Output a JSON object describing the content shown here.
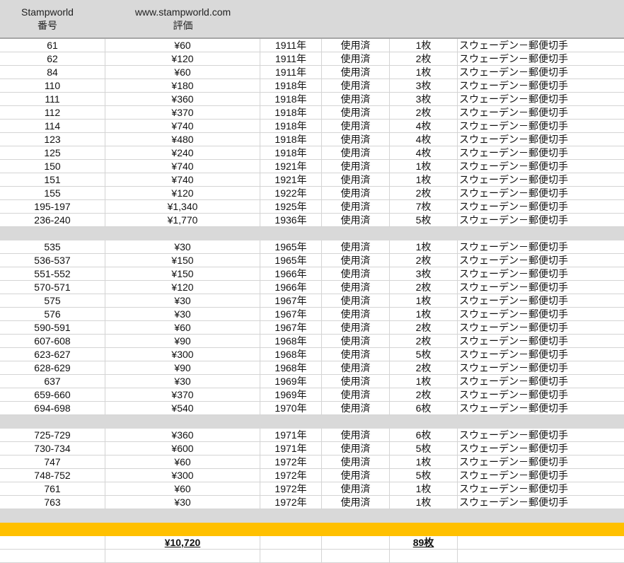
{
  "header": {
    "col_number_line1": "Stampworld",
    "col_number_line2": "番号",
    "col_value_line1": "www.stampworld.com",
    "col_value_line2": "評価"
  },
  "groups": [
    [
      [
        "61",
        "¥60",
        "1911年",
        "使用済",
        "1枚",
        "スウェーデン－郵便切手"
      ],
      [
        "62",
        "¥120",
        "1911年",
        "使用済",
        "2枚",
        "スウェーデン－郵便切手"
      ],
      [
        "84",
        "¥60",
        "1911年",
        "使用済",
        "1枚",
        "スウェーデン－郵便切手"
      ],
      [
        "110",
        "¥180",
        "1918年",
        "使用済",
        "3枚",
        "スウェーデン－郵便切手"
      ],
      [
        "111",
        "¥360",
        "1918年",
        "使用済",
        "3枚",
        "スウェーデン－郵便切手"
      ],
      [
        "112",
        "¥370",
        "1918年",
        "使用済",
        "2枚",
        "スウェーデン－郵便切手"
      ],
      [
        "114",
        "¥740",
        "1918年",
        "使用済",
        "4枚",
        "スウェーデン－郵便切手"
      ],
      [
        "123",
        "¥480",
        "1918年",
        "使用済",
        "4枚",
        "スウェーデン－郵便切手"
      ],
      [
        "125",
        "¥240",
        "1918年",
        "使用済",
        "4枚",
        "スウェーデン－郵便切手"
      ],
      [
        "150",
        "¥740",
        "1921年",
        "使用済",
        "1枚",
        "スウェーデン－郵便切手"
      ],
      [
        "151",
        "¥740",
        "1921年",
        "使用済",
        "1枚",
        "スウェーデン－郵便切手"
      ],
      [
        "155",
        "¥120",
        "1922年",
        "使用済",
        "2枚",
        "スウェーデン－郵便切手"
      ],
      [
        "195-197",
        "¥1,340",
        "1925年",
        "使用済",
        "7枚",
        "スウェーデン－郵便切手"
      ],
      [
        "236-240",
        "¥1,770",
        "1936年",
        "使用済",
        "5枚",
        "スウェーデン－郵便切手"
      ]
    ],
    [
      [
        "535",
        "¥30",
        "1965年",
        "使用済",
        "1枚",
        "スウェーデン－郵便切手"
      ],
      [
        "536-537",
        "¥150",
        "1965年",
        "使用済",
        "2枚",
        "スウェーデン－郵便切手"
      ],
      [
        "551-552",
        "¥150",
        "1966年",
        "使用済",
        "3枚",
        "スウェーデン－郵便切手"
      ],
      [
        "570-571",
        "¥120",
        "1966年",
        "使用済",
        "2枚",
        "スウェーデン－郵便切手"
      ],
      [
        "575",
        "¥30",
        "1967年",
        "使用済",
        "1枚",
        "スウェーデン－郵便切手"
      ],
      [
        "576",
        "¥30",
        "1967年",
        "使用済",
        "1枚",
        "スウェーデン－郵便切手"
      ],
      [
        "590-591",
        "¥60",
        "1967年",
        "使用済",
        "2枚",
        "スウェーデン－郵便切手"
      ],
      [
        "607-608",
        "¥90",
        "1968年",
        "使用済",
        "2枚",
        "スウェーデン－郵便切手"
      ],
      [
        "623-627",
        "¥300",
        "1968年",
        "使用済",
        "5枚",
        "スウェーデン－郵便切手"
      ],
      [
        "628-629",
        "¥90",
        "1968年",
        "使用済",
        "2枚",
        "スウェーデン－郵便切手"
      ],
      [
        "637",
        "¥30",
        "1969年",
        "使用済",
        "1枚",
        "スウェーデン－郵便切手"
      ],
      [
        "659-660",
        "¥370",
        "1969年",
        "使用済",
        "2枚",
        "スウェーデン－郵便切手"
      ],
      [
        "694-698",
        "¥540",
        "1970年",
        "使用済",
        "6枚",
        "スウェーデン－郵便切手"
      ]
    ],
    [
      [
        "725-729",
        "¥360",
        "1971年",
        "使用済",
        "6枚",
        "スウェーデン－郵便切手"
      ],
      [
        "730-734",
        "¥600",
        "1971年",
        "使用済",
        "5枚",
        "スウェーデン－郵便切手"
      ],
      [
        "747",
        "¥60",
        "1972年",
        "使用済",
        "1枚",
        "スウェーデン－郵便切手"
      ],
      [
        "748-752",
        "¥300",
        "1972年",
        "使用済",
        "5枚",
        "スウェーデン－郵便切手"
      ],
      [
        "761",
        "¥60",
        "1972年",
        "使用済",
        "1枚",
        "スウェーデン－郵便切手"
      ],
      [
        "763",
        "¥30",
        "1972年",
        "使用済",
        "1枚",
        "スウェーデン－郵便切手"
      ]
    ]
  ],
  "totals": {
    "value": "¥10,720",
    "count": "89枚"
  },
  "colors": {
    "header": "#d9d9d9",
    "separator": "#d9d9d9",
    "total_bar": "#ffc000"
  }
}
